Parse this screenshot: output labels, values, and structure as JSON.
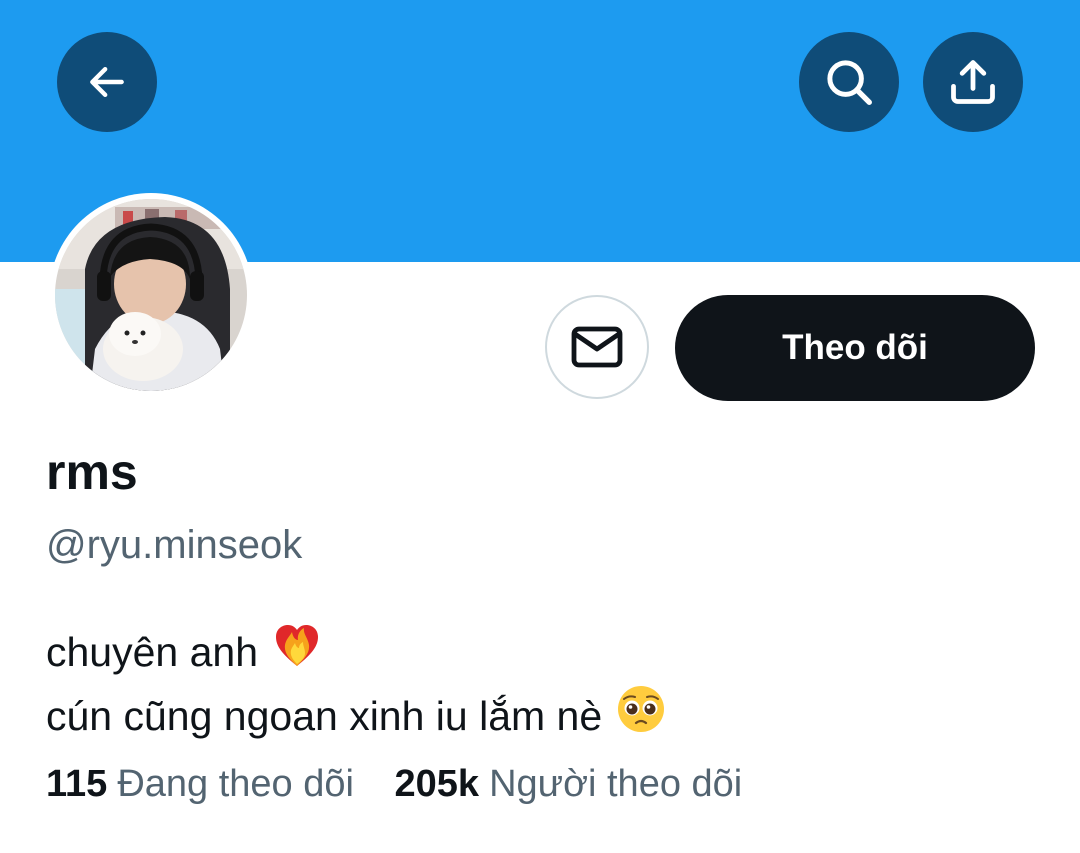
{
  "colors": {
    "banner": "#1d9bf0",
    "header_button_bg": "#0f4c78",
    "follow_button_bg": "#0f1419",
    "secondary_text": "#536471"
  },
  "header": {
    "back_icon": "arrow-left-icon",
    "search_icon": "search-icon",
    "share_icon": "share-icon"
  },
  "profile": {
    "avatar_icon": "avatar-photo",
    "message_icon": "mail-icon",
    "follow_label": "Theo dõi",
    "display_name": "rms",
    "handle": "@ryu.minseok",
    "bio_line1": "chuyên anh",
    "bio_line1_emoji": "heart-on-fire-emoji",
    "bio_line2": "cún cũng ngoan xinh iu lắm nè",
    "bio_line2_emoji": "pleading-face-emoji"
  },
  "stats": {
    "following_count": "115",
    "following_label": "Đang theo dõi",
    "followers_count": "205k",
    "followers_label": "Người theo dõi"
  }
}
